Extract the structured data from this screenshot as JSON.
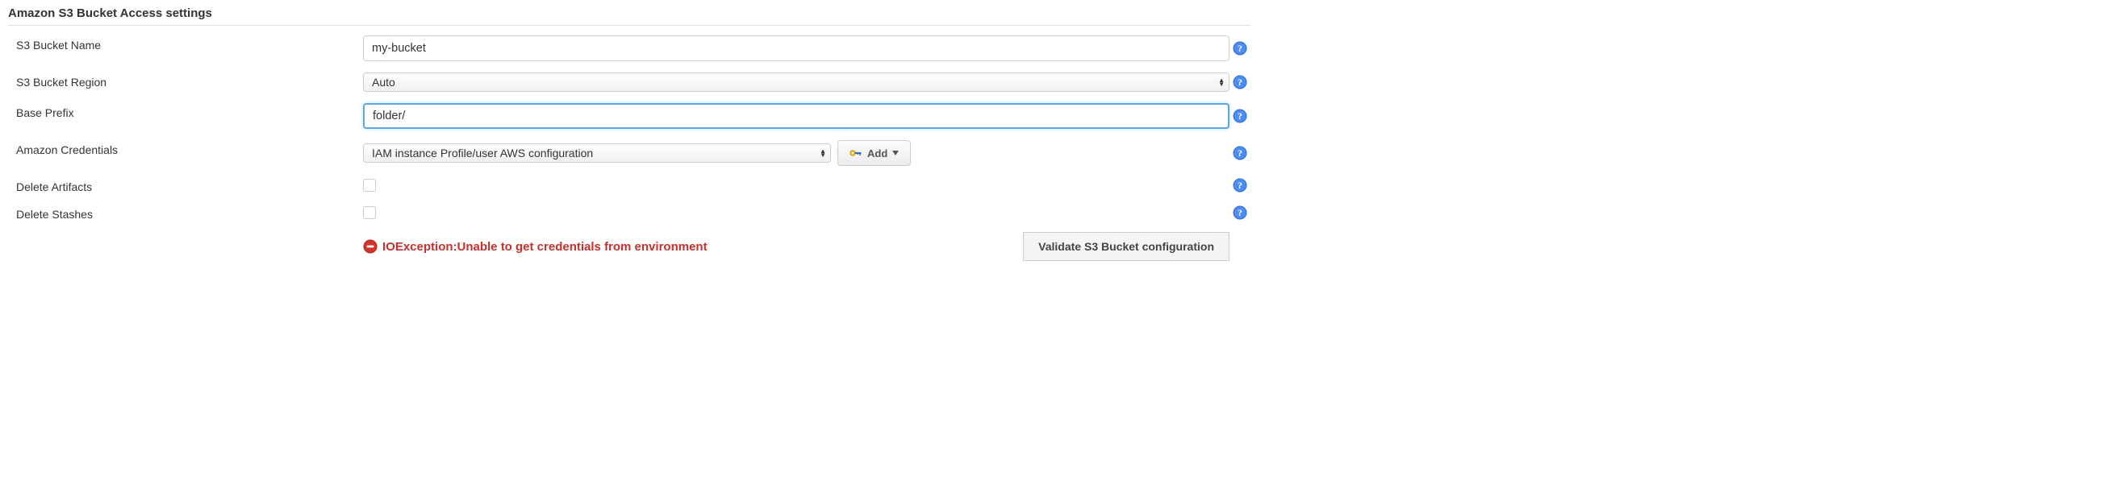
{
  "section_title": "Amazon S3 Bucket Access settings",
  "fields": {
    "bucket_name": {
      "label": "S3 Bucket Name",
      "value": "my-bucket"
    },
    "bucket_region": {
      "label": "S3 Bucket Region",
      "value": "Auto"
    },
    "base_prefix": {
      "label": "Base Prefix",
      "value": "folder/"
    },
    "credentials": {
      "label": "Amazon Credentials",
      "value": "IAM instance Profile/user AWS configuration",
      "add_label": "Add"
    },
    "delete_artifacts": {
      "label": "Delete Artifacts",
      "checked": false
    },
    "delete_stashes": {
      "label": "Delete Stashes",
      "checked": false
    }
  },
  "error_message": "IOException:Unable to get credentials from environment",
  "validate_button": "Validate S3 Bucket configuration"
}
